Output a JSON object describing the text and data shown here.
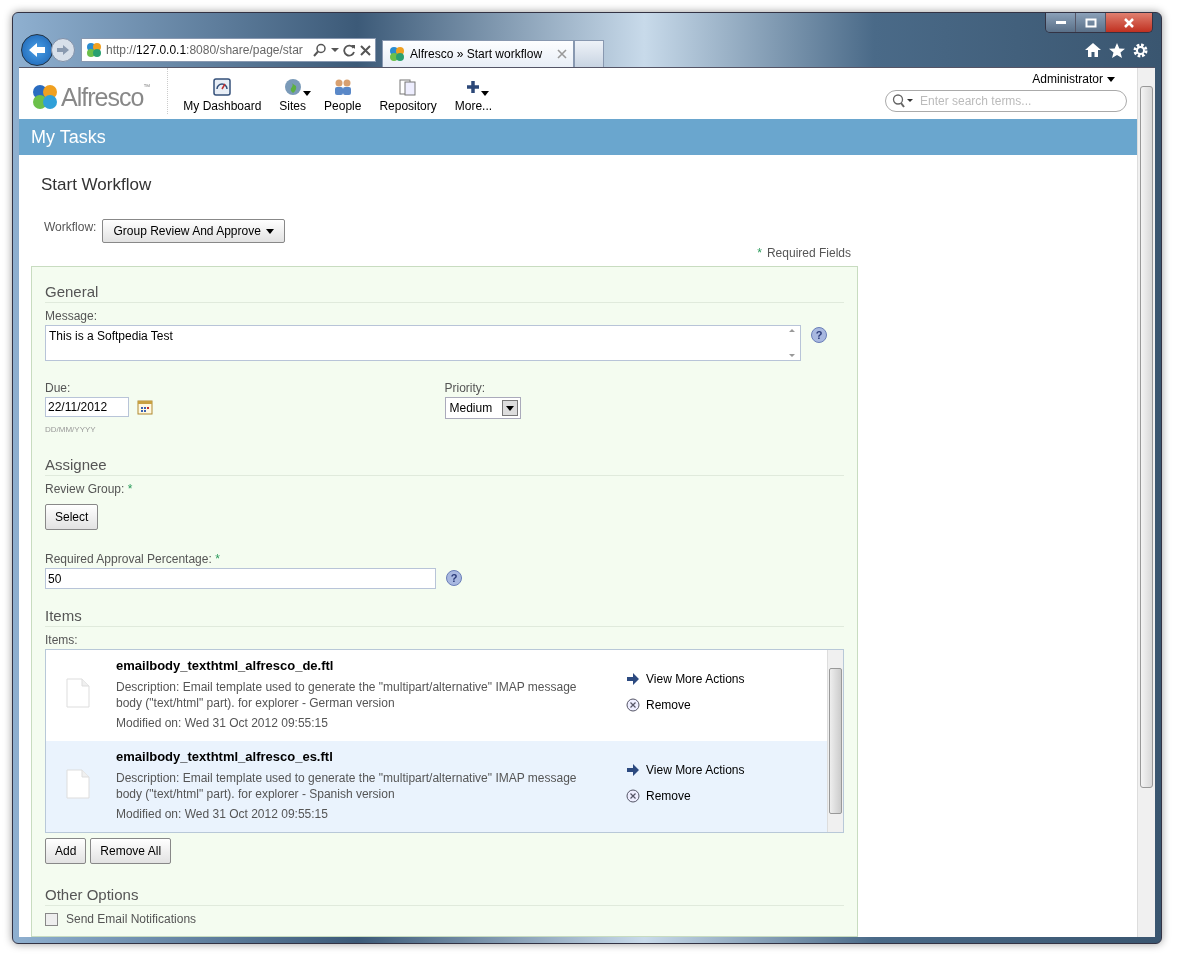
{
  "browser": {
    "url_prefix": "http://",
    "url_host": "127.0.0.1",
    "url_rest": ":8080/share/page/star",
    "tab_title": "Alfresco » Start workflow"
  },
  "header": {
    "logo_text": "Alfresco",
    "logo_tm": "™",
    "nav": [
      {
        "label": "My Dashboard",
        "kind": "dashboard",
        "has_menu": false
      },
      {
        "label": "Sites",
        "kind": "sites",
        "has_menu": true
      },
      {
        "label": "People",
        "kind": "people",
        "has_menu": false
      },
      {
        "label": "Repository",
        "kind": "repository",
        "has_menu": false
      },
      {
        "label": "More...",
        "kind": "more",
        "has_menu": true
      }
    ],
    "user_menu": "Administrator",
    "search": {
      "placeholder": "Enter search terms..."
    }
  },
  "title_bar": "My Tasks",
  "page_title": "Start Workflow",
  "workflow": {
    "label": "Workflow:",
    "value": "Group Review And Approve"
  },
  "required_note": {
    "mark": "*",
    "text": "Required Fields"
  },
  "general": {
    "heading": "General",
    "message_label": "Message:",
    "message_value": "This is a Softpedia Test",
    "due_label": "Due:",
    "due_value": "22/11/2012",
    "due_hint": "DD/MM/YYYY",
    "priority_label": "Priority:",
    "priority_value": "Medium"
  },
  "assignee": {
    "heading": "Assignee",
    "group_label": "Review Group:",
    "group_mark": "*",
    "select_button": "Select",
    "percent_label": "Required Approval Percentage:",
    "percent_mark": "*",
    "percent_value": "50"
  },
  "items": {
    "heading": "Items",
    "label": "Items:",
    "rows": [
      {
        "name": "emailbody_texthtml_alfresco_de.ftl",
        "description": "Description: Email template used to generate the \"multipart/alternative\" IMAP message body (\"text/html\" part). for explorer - German version",
        "modified": "Modified on: Wed 31 Oct 2012 09:55:15",
        "action_more": "View More Actions",
        "action_remove": "Remove",
        "selected": false
      },
      {
        "name": "emailbody_texthtml_alfresco_es.ftl",
        "description": "Description: Email template used to generate the \"multipart/alternative\" IMAP message body (\"text/html\" part). for explorer - Spanish version",
        "modified": "Modified on: Wed 31 Oct 2012 09:55:15",
        "action_more": "View More Actions",
        "action_remove": "Remove",
        "selected": true
      }
    ],
    "add_button": "Add",
    "remove_all_button": "Remove All"
  },
  "help_glyph": "?",
  "other": {
    "heading": "Other Options",
    "notify_label": "Send Email Notifications",
    "notify_checked": false
  }
}
